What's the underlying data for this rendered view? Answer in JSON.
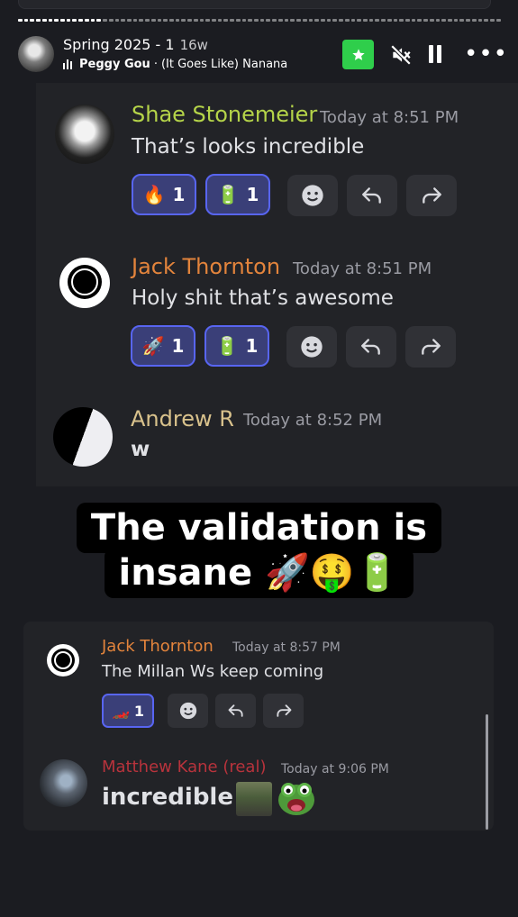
{
  "story": {
    "title": "Spring 2025 - 1",
    "age": "16w",
    "artist": "Peggy Gou",
    "separator": "·",
    "song": "(It Goes Like) Nanana"
  },
  "messages": [
    {
      "username": "Shae Stonemeier",
      "username_color": "#b5d449",
      "timestamp": "Today at 8:51 PM",
      "text": "That’s looks incredible",
      "reactions": [
        {
          "emoji": "🔥",
          "count": "1"
        },
        {
          "emoji": "🔋",
          "count": "1"
        }
      ]
    },
    {
      "username": "Jack Thornton",
      "username_color": "#e3843c",
      "timestamp": "Today at 8:51 PM",
      "text": "Holy shit that’s awesome",
      "reactions": [
        {
          "emoji": "🚀",
          "count": "1"
        },
        {
          "emoji": "🔋",
          "count": "1"
        }
      ]
    },
    {
      "username": "Andrew R",
      "username_color": "#d9c28c",
      "timestamp": "Today at 8:52 PM",
      "text": "w"
    },
    {
      "username": "Jack Thornton",
      "username_color": "#e3843c",
      "timestamp": "Today at 8:57 PM",
      "text": "The Millan Ws keep coming",
      "reactions": [
        {
          "emoji": "🏎️",
          "count": "1"
        }
      ]
    },
    {
      "username": "Matthew Kane (real)",
      "username_color": "#b8333c",
      "timestamp": "Today at 9:06 PM",
      "text": "incredible"
    }
  ],
  "caption": {
    "line1": "The validation is",
    "line2": "insane 🚀🤑🔋"
  },
  "icons": {
    "star": "star-icon",
    "mute": "speaker-muted-icon",
    "pause": "pause-icon",
    "more": "more-icon",
    "add_reaction": "smiley-icon",
    "reply": "reply-arrow-icon",
    "forward": "forward-arrow-icon"
  },
  "colors": {
    "background": "#1b1c21",
    "panel": "#222327",
    "reaction_bg": "#3a3f78",
    "reaction_border": "#5865f2",
    "star_button": "#2fce4b"
  }
}
